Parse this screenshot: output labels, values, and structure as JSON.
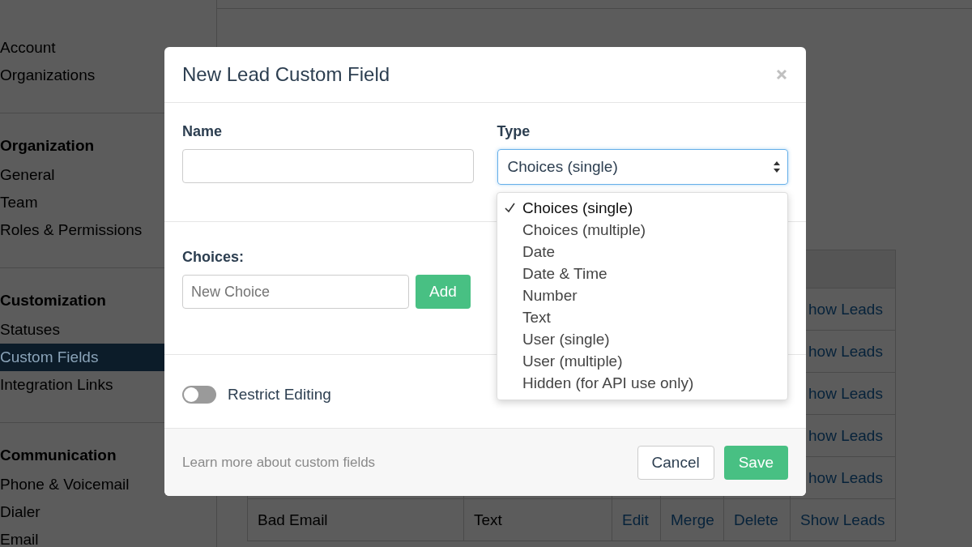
{
  "sidebar": {
    "sections": [
      {
        "items": [
          {
            "label": "Account",
            "selected": false
          },
          {
            "label": "Organizations",
            "selected": false
          }
        ]
      },
      {
        "heading": "Organization",
        "items": [
          {
            "label": "General",
            "selected": false
          },
          {
            "label": "Team",
            "selected": false
          },
          {
            "label": "Roles & Permissions",
            "selected": false
          }
        ]
      },
      {
        "heading": "Customization",
        "items": [
          {
            "label": "Statuses",
            "selected": false
          },
          {
            "label": "Custom Fields",
            "selected": true
          },
          {
            "label": "Integration Links",
            "selected": false
          }
        ]
      },
      {
        "heading": "Communication",
        "items": [
          {
            "label": "Phone & Voicemail",
            "selected": false
          },
          {
            "label": "Dialer",
            "selected": false
          },
          {
            "label": "Email",
            "selected": false
          }
        ]
      }
    ]
  },
  "table": {
    "rows": [
      {
        "show_leads": "how Leads"
      },
      {
        "show_leads": "how Leads"
      },
      {
        "show_leads": "how Leads"
      },
      {
        "show_leads": "how Leads"
      },
      {
        "show_leads": "how Leads"
      },
      {
        "name": "Bad Email",
        "type": "Text",
        "edit": "Edit",
        "merge": "Merge",
        "delete": "Delete",
        "show_leads": "Show Leads"
      }
    ]
  },
  "modal": {
    "title": "New Lead Custom Field",
    "name_label": "Name",
    "type_label": "Type",
    "type_value": "Choices (single)",
    "type_options": [
      {
        "label": "Choices (single)",
        "selected": true
      },
      {
        "label": "Choices (multiple)",
        "selected": false
      },
      {
        "label": "Date",
        "selected": false
      },
      {
        "label": "Date & Time",
        "selected": false
      },
      {
        "label": "Number",
        "selected": false
      },
      {
        "label": "Text",
        "selected": false
      },
      {
        "label": "User (single)",
        "selected": false
      },
      {
        "label": "User (multiple)",
        "selected": false
      },
      {
        "label": "Hidden (for API use only)",
        "selected": false
      }
    ],
    "choices_label": "Choices:",
    "choice_placeholder": "New Choice",
    "add_button": "Add",
    "restrict_editing": {
      "label": "Restrict Editing",
      "on": false
    },
    "footer_link": "Learn more about custom fields",
    "cancel_button": "Cancel",
    "save_button": "Save"
  }
}
